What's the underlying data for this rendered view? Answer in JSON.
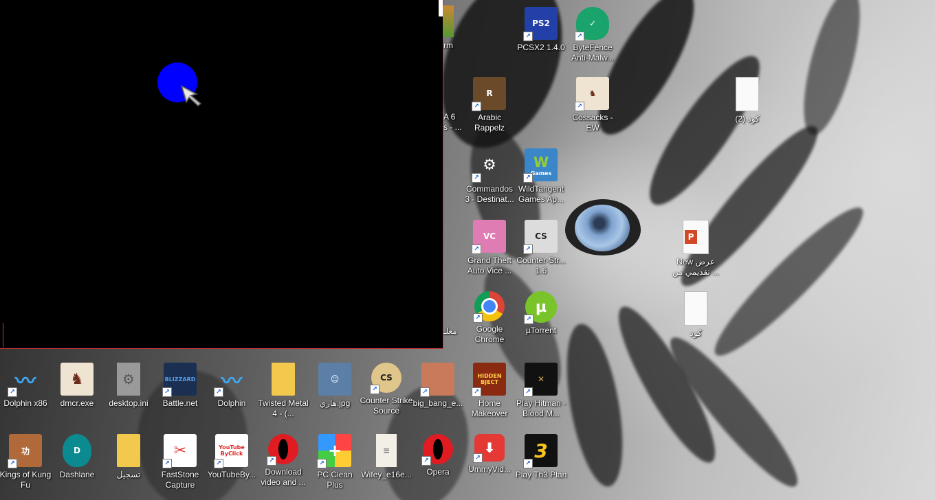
{
  "desktop": {
    "partial_labels": [
      "rm",
      "A 6",
      "s - ...",
      "معلـ"
    ],
    "icons": [
      {
        "label": "PCSX2 1.4.0",
        "icon": "pcsx2-icon"
      },
      {
        "label": "ByteFence Anti-Malw...",
        "icon": "bytefence-shield-icon"
      },
      {
        "label": "Arabic Rappelz",
        "icon": "rappelz-icon"
      },
      {
        "label": "Cossacks - EW",
        "icon": "cossacks-icon"
      },
      {
        "label": "(2) كود",
        "icon": "blank-file-icon"
      },
      {
        "label": "Commandos 3 - Destinat...",
        "icon": "commandos-icon"
      },
      {
        "label": "WildTangent Games Ap...",
        "icon": "wildtangent-icon"
      },
      {
        "label": "Grand Theft Auto Vice ...",
        "icon": "gta-vice-city-icon"
      },
      {
        "label": "Counter-Str... 1.6",
        "icon": "counter-strike-icon"
      },
      {
        "label": "New عرض تقديمي من ...",
        "icon": "powerpoint-file-icon"
      },
      {
        "label": "Google Chrome",
        "icon": "chrome-icon"
      },
      {
        "label": "µTorrent",
        "icon": "utorrent-icon"
      },
      {
        "label": "كود",
        "icon": "blank-file-icon"
      },
      {
        "label": "Dolphin x86",
        "icon": "dolphin-icon"
      },
      {
        "label": "dmcr.exe",
        "icon": "cossacks-icon"
      },
      {
        "label": "desktop.ini",
        "icon": "gear-file-icon"
      },
      {
        "label": "Battle.net",
        "icon": "battlenet-icon"
      },
      {
        "label": "Dolphin",
        "icon": "dolphin-icon"
      },
      {
        "label": "Twisted Metal 4 - (...",
        "icon": "folder-icon"
      },
      {
        "label": "هاري.jpg",
        "icon": "photo-icon"
      },
      {
        "label": "Counter Strike Source",
        "icon": "counter-strike-source-icon"
      },
      {
        "label": "big_bang_e...",
        "icon": "bigbang-image-icon"
      },
      {
        "label": "Home Makeover",
        "icon": "hidden-object-icon"
      },
      {
        "label": "Play Hitman - Blood M...",
        "icon": "hitman-icon"
      },
      {
        "label": "Kings of Kung Fu",
        "icon": "kung-fu-icon"
      },
      {
        "label": "Dashlane",
        "icon": "dashlane-icon"
      },
      {
        "label": "تسجيل",
        "icon": "folder-icon"
      },
      {
        "label": "FastStone Capture",
        "icon": "faststone-icon"
      },
      {
        "label": "YouTubeBy...",
        "icon": "youtube-byclick-icon"
      },
      {
        "label": "Download video and ...",
        "icon": "opera-icon"
      },
      {
        "label": "PC Clean Plus",
        "icon": "pc-clean-plus-icon"
      },
      {
        "label": "Wifey_e16e...",
        "icon": "document-image-icon"
      },
      {
        "label": "Opera",
        "icon": "opera-icon"
      },
      {
        "label": "UmmyVid...",
        "icon": "ummy-download-icon"
      },
      {
        "label": "Play Th3 Plan",
        "icon": "th3-plan-icon"
      }
    ],
    "icon_glyphs": {
      "YouTubeBy": "YouTube ByClick",
      "WildTangent": "Games",
      "Battle": "BLIZZARD",
      "Home": "HIDDEN BJECT",
      "Th3": "3"
    }
  }
}
